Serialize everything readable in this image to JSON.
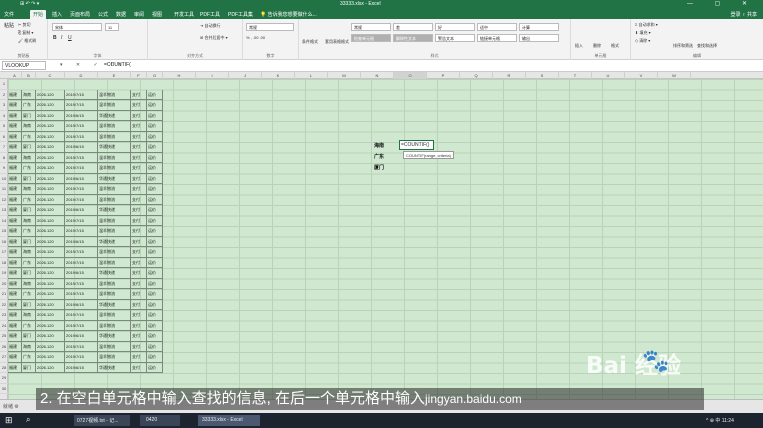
{
  "window": {
    "title": "33333.xlsx - Excel",
    "quick_access": "⊞ ↶ ↷ ▾",
    "controls": "— ▢ ✕"
  },
  "tabs": [
    "文件",
    "开始",
    "插入",
    "页面布局",
    "公式",
    "数据",
    "审阅",
    "视图",
    "开发工具",
    "PDF工具",
    "PDF工具集",
    "💡 告诉我您想要做什么..."
  ],
  "active_tab": 1,
  "login": "登录 ♀ 共享",
  "ribbon": {
    "clipboard": {
      "label": "剪贴板",
      "cut": "✂ 剪切",
      "copy": "⎘ 复制 ▾",
      "painter": "🖌 格式刷",
      "paste": "粘贴"
    },
    "font": {
      "label": "字体",
      "font_name": "宋体",
      "font_size": "11",
      "bold": "B",
      "italic": "I",
      "underline": "U"
    },
    "alignment": {
      "label": "对齐方式",
      "wrap": "⇥ 自动换行",
      "merge": "⊞ 合并后居中 ▾"
    },
    "number": {
      "label": "数字",
      "format": "常规",
      "pct": "% , .00 .00"
    },
    "styles": {
      "label": "样式",
      "cond": "条件格式",
      "table": "套用表格格式",
      "boxes": [
        "常规",
        "差",
        "好",
        "适中",
        "计算",
        "检查单元格",
        "解释性文本",
        "警告文本",
        "链接单元格",
        "输出"
      ]
    },
    "cells": {
      "label": "单元格",
      "insert": "插入",
      "delete": "删除",
      "format": "格式"
    },
    "editing": {
      "label": "编辑",
      "autosum": "Σ 自动求和 ▾",
      "fill": "⬇ 填充 ▾",
      "clear": "◇ 清除 ▾",
      "sort": "排序和筛选",
      "find": "查找和选择"
    }
  },
  "formula_bar": {
    "name_box": "VLOOKUP",
    "icons": "▾ ✕ ✓ fx",
    "formula": "=COUNTIF("
  },
  "columns": [
    "A",
    "B",
    "C",
    "D",
    "E",
    "F",
    "G",
    "H",
    "I",
    "J",
    "K",
    "L",
    "M",
    "N",
    "O",
    "P",
    "Q",
    "R",
    "S",
    "T",
    "U",
    "V",
    "W"
  ],
  "selected_column": "O",
  "rows": [
    [
      "福建",
      "海南",
      "2026.120",
      "2019/7/15",
      "温羊物流",
      "支付",
      "运价"
    ],
    [
      "福建",
      "广东",
      "2026.120",
      "2019/7/15",
      "温羊物流",
      "支付",
      "运价"
    ],
    [
      "福建",
      "厦门",
      "2026.120",
      "2019/6/15",
      "华通快递",
      "支付",
      "运价"
    ],
    [
      "福建",
      "海南",
      "2026.120",
      "2019/7/15",
      "温羊物流",
      "支付",
      "运价"
    ],
    [
      "福建",
      "广东",
      "2026.120",
      "2019/7/15",
      "温羊物流",
      "支付",
      "运价"
    ],
    [
      "福建",
      "厦门",
      "2026.120",
      "2019/6/15",
      "华通快递",
      "支付",
      "运价"
    ],
    [
      "福建",
      "海南",
      "2026.120",
      "2019/7/15",
      "温羊物流",
      "支付",
      "运价"
    ],
    [
      "福建",
      "广东",
      "2026.120",
      "2019/7/15",
      "温羊物流",
      "支付",
      "运价"
    ],
    [
      "福建",
      "厦门",
      "2026.120",
      "2019/6/15",
      "华通快递",
      "支付",
      "运价"
    ],
    [
      "福建",
      "海南",
      "2026.120",
      "2019/7/15",
      "温羊物流",
      "支付",
      "运价"
    ],
    [
      "福建",
      "广东",
      "2026.120",
      "2019/7/15",
      "温羊物流",
      "支付",
      "运价"
    ],
    [
      "福建",
      "厦门",
      "2026.120",
      "2019/6/15",
      "华通快递",
      "支付",
      "运价"
    ],
    [
      "福建",
      "海南",
      "2026.120",
      "2019/7/15",
      "温羊物流",
      "支付",
      "运价"
    ],
    [
      "福建",
      "广东",
      "2026.120",
      "2019/7/15",
      "温羊物流",
      "支付",
      "运价"
    ],
    [
      "福建",
      "厦门",
      "2026.120",
      "2019/6/15",
      "华通快递",
      "支付",
      "运价"
    ],
    [
      "福建",
      "海南",
      "2026.120",
      "2019/7/15",
      "温羊物流",
      "支付",
      "运价"
    ],
    [
      "福建",
      "广东",
      "2026.120",
      "2019/7/15",
      "温羊物流",
      "支付",
      "运价"
    ],
    [
      "福建",
      "厦门",
      "2026.120",
      "2019/6/15",
      "华通快递",
      "支付",
      "运价"
    ],
    [
      "福建",
      "海南",
      "2026.120",
      "2019/7/15",
      "温羊物流",
      "支付",
      "运价"
    ],
    [
      "福建",
      "广东",
      "2026.120",
      "2019/7/15",
      "温羊物流",
      "支付",
      "运价"
    ],
    [
      "福建",
      "厦门",
      "2026.120",
      "2019/6/15",
      "华通快递",
      "支付",
      "运价"
    ],
    [
      "福建",
      "海南",
      "2026.120",
      "2019/7/15",
      "温羊物流",
      "支付",
      "运价"
    ],
    [
      "福建",
      "广东",
      "2026.120",
      "2019/7/15",
      "温羊物流",
      "支付",
      "运价"
    ],
    [
      "福建",
      "厦门",
      "2026.120",
      "2019/6/15",
      "华通快递",
      "支付",
      "运价"
    ],
    [
      "福建",
      "海南",
      "2026.120",
      "2019/7/15",
      "温羊物流",
      "支付",
      "运价"
    ],
    [
      "福建",
      "广东",
      "2026.120",
      "2019/7/15",
      "温羊物流",
      "支付",
      "运价"
    ],
    [
      "福建",
      "厦门",
      "2026.120",
      "2019/6/15",
      "华通快递",
      "支付",
      "运价"
    ]
  ],
  "lookup_labels": [
    "海南",
    "广东",
    "厦门"
  ],
  "edit_cell": "=COUNTIF()",
  "tooltip": "COUNTIF(range, criteria)",
  "sheet_bar": "就绪  ⚙",
  "caption": "2. 在空白单元格中输入查找的信息, 在后一个单元格中输入",
  "watermark": "Bai 经验",
  "watermark_url": "jingyan.baidu.com",
  "taskbar": {
    "start": "⊞",
    "search": "⌕",
    "items": [
      "0727视频.txt - 记...",
      "0420",
      "33333.xlsx - Excel"
    ],
    "tray": "^ ⊕ 中 11:24"
  },
  "colors": {
    "excel_green": "#217346",
    "grid_bg": "#cfe8cf",
    "taskbar": "#1c2430"
  }
}
